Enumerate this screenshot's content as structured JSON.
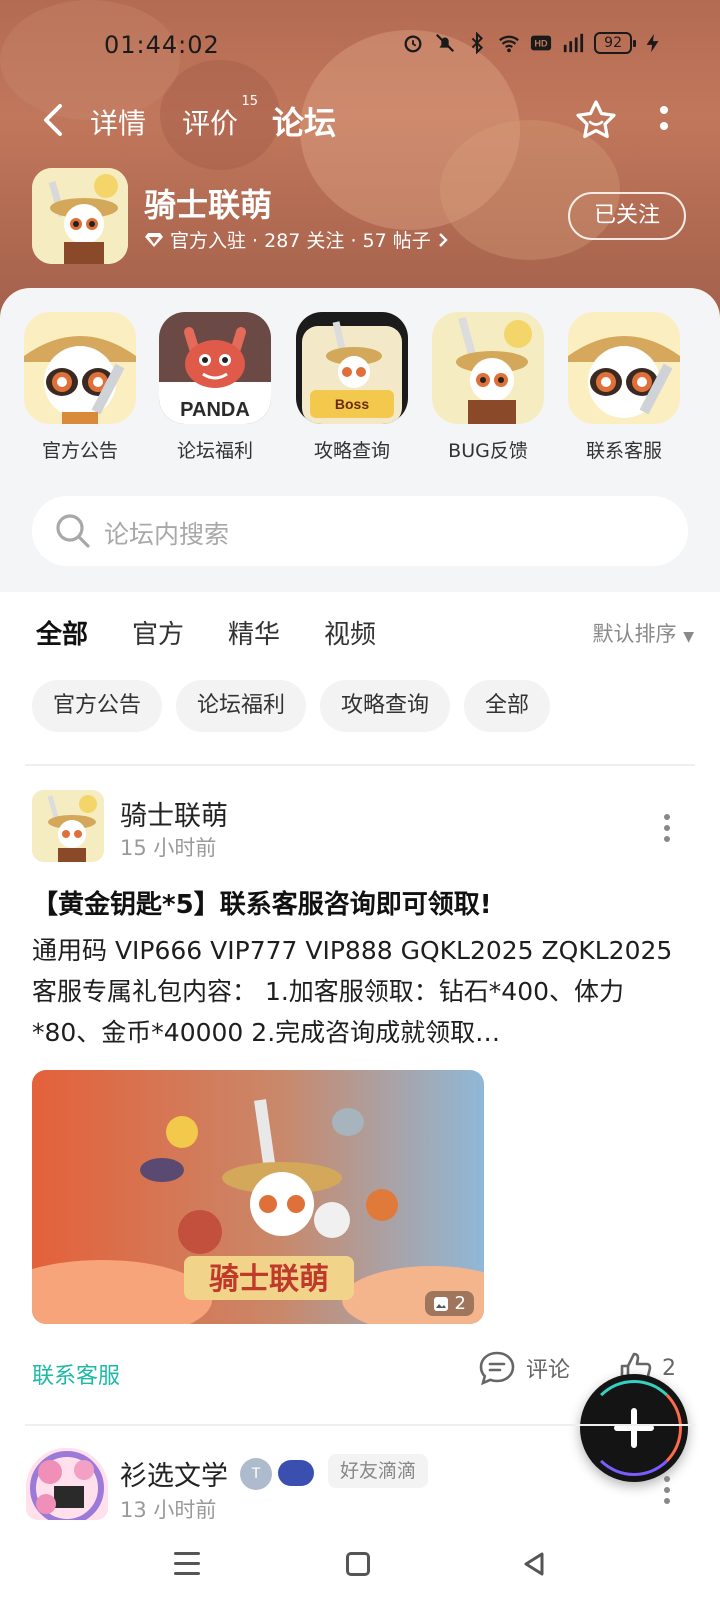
{
  "status_bar": {
    "time": "01:44:02",
    "battery": "92"
  },
  "nav": {
    "tabs": [
      {
        "label": "详情"
      },
      {
        "label": "评价",
        "badge": "15"
      },
      {
        "label": "论坛",
        "active": true
      }
    ]
  },
  "app": {
    "name": "骑士联萌",
    "meta": "官方入驻 · 287 关注 · 57 帖子",
    "follow_label": "已关注"
  },
  "shortcuts": [
    {
      "label": "官方公告",
      "icon": "panda-knight-icon"
    },
    {
      "label": "论坛福利",
      "icon": "panda-dragon-icon",
      "icon_text": "PANDA"
    },
    {
      "label": "攻略查询",
      "icon": "boss-guide-icon"
    },
    {
      "label": "BUG反馈",
      "icon": "panda-knight-icon"
    },
    {
      "label": "联系客服",
      "icon": "panda-knight-icon"
    }
  ],
  "search": {
    "placeholder": "论坛内搜索"
  },
  "filter_tabs": [
    {
      "label": "全部",
      "active": true
    },
    {
      "label": "官方"
    },
    {
      "label": "精华"
    },
    {
      "label": "视频"
    }
  ],
  "sort_label": "默认排序",
  "chips": [
    "官方公告",
    "论坛福利",
    "攻略查询",
    "全部"
  ],
  "posts": [
    {
      "author": "骑士联萌",
      "time": "15 小时前",
      "title": "【黄金钥匙*5】联系客服咨询即可领取!",
      "body": "通用码 VIP666 VIP777 VIP888 GQKL2025 ZQKL2025 客服专属礼包内容： 1.加客服领取：钻石*400、体力*80、金币*40000 2.完成咨询成就领取…",
      "image_count": "2",
      "tag": "联系客服",
      "comment_label": "评论",
      "likes": "2"
    },
    {
      "author": "衫选文学",
      "badge": "好友滴滴",
      "time": "13 小时前"
    }
  ],
  "colors": {
    "accent": "#30d0bf",
    "tag_color": "#1fb9a8",
    "hero_bg": "#b36b52"
  }
}
